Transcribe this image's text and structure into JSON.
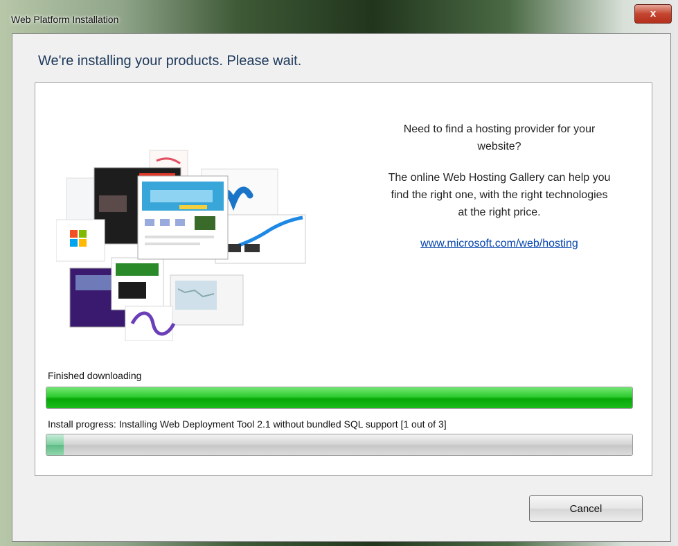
{
  "window": {
    "title": "Web Platform Installation",
    "close_glyph": "x"
  },
  "heading": "We're installing your products. Please wait.",
  "promo": {
    "line1": "Need to find a hosting provider for your website?",
    "line2": "The online Web Hosting Gallery can help you find the right one, with the right technologies at the right price.",
    "link": "www.microsoft.com/web/hosting"
  },
  "download": {
    "label": "Finished downloading",
    "progress": 1.0
  },
  "install": {
    "label": "Install progress: Installing Web Deployment Tool 2.1 without bundled SQL support [1 out of 3]",
    "progress": 0.03
  },
  "buttons": {
    "cancel": "Cancel"
  },
  "colors": {
    "download_bar": "#1dbb1d",
    "install_bar": "#7fcf9f",
    "link": "#0645ad",
    "heading": "#1e395b"
  }
}
